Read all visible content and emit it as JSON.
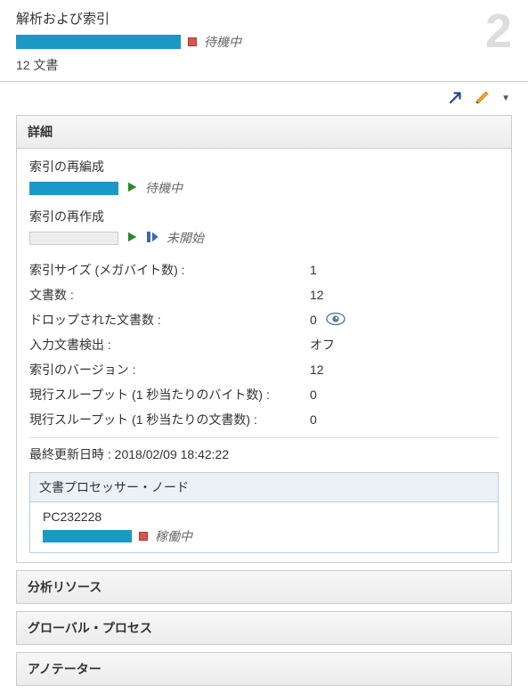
{
  "header": {
    "title": "解析および索引",
    "status": "待機中",
    "doc_count_text": "12 文書",
    "big_number": "2"
  },
  "detail_panel": {
    "title": "詳細",
    "reorg": {
      "label": "索引の再編成",
      "status": "待機中"
    },
    "rebuild": {
      "label": "索引の再作成",
      "status": "未開始"
    },
    "kv": [
      {
        "key": "索引サイズ (メガバイト数) :",
        "val": "1"
      },
      {
        "key": "文書数 :",
        "val": "12"
      },
      {
        "key": "ドロップされた文書数 :",
        "val": "0",
        "eye": true
      },
      {
        "key": "入力文書検出 :",
        "val": "オフ"
      },
      {
        "key": "索引のバージョン :",
        "val": "12"
      },
      {
        "key": "現行スループット (1 秒当たりのバイト数) :",
        "val": "0"
      },
      {
        "key": "現行スループット (1 秒当たりの文書数) :",
        "val": "0"
      }
    ],
    "last_update_label": "最終更新日時 :",
    "last_update_value": "2018/02/09 18:42:22",
    "node_section": {
      "title": "文書プロセッサー・ノード",
      "node_name": "PC232228",
      "node_status": "稼働中"
    }
  },
  "collapsed_panels": [
    "分析リソース",
    "グローバル・プロセス",
    "アノテーター"
  ]
}
